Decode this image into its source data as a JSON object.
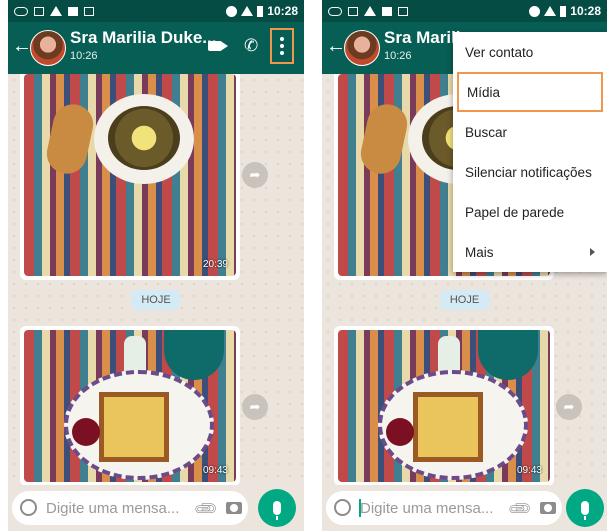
{
  "status": {
    "time": "10:28"
  },
  "chat": {
    "contact_left": "Sra Marilia Duke...",
    "contact_right": "Sra Marilia",
    "last_seen": "10:26",
    "date_divider": "HOJE",
    "messages": [
      {
        "time": "20:39"
      },
      {
        "time": "09:43"
      }
    ]
  },
  "input": {
    "placeholder": "Digite uma mensa..."
  },
  "menu": {
    "items": [
      {
        "label": "Ver contato"
      },
      {
        "label": "Mídia"
      },
      {
        "label": "Buscar"
      },
      {
        "label": "Silenciar notificações"
      },
      {
        "label": "Papel de parede"
      },
      {
        "label": "Mais"
      }
    ]
  },
  "colors": {
    "header": "#075e54",
    "status": "#054d44",
    "accent": "#00a884",
    "highlight": "#f0974d",
    "chat_bg": "#ece5dd"
  }
}
